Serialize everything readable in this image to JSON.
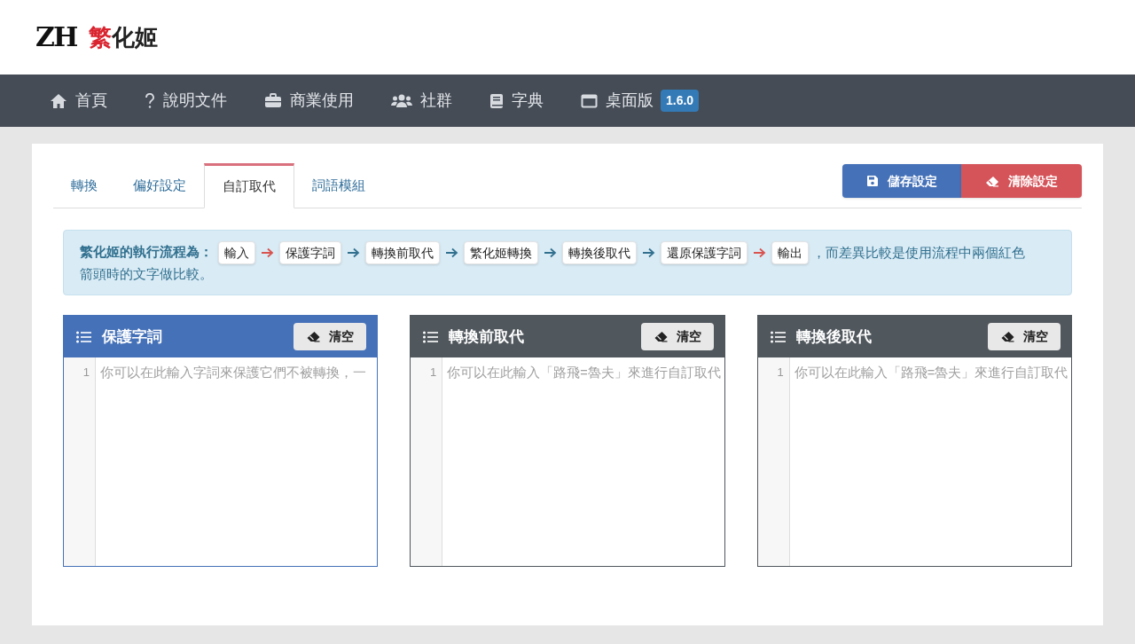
{
  "logo": {
    "mark": "ZH",
    "name_accent": "繁",
    "name_rest": "化姬"
  },
  "nav": [
    {
      "label": "首頁"
    },
    {
      "label": "說明文件"
    },
    {
      "label": "商業使用"
    },
    {
      "label": "社群"
    },
    {
      "label": "字典"
    },
    {
      "label": "桌面版",
      "badge": "1.6.0"
    }
  ],
  "tabs": [
    {
      "label": "轉換",
      "selected": false
    },
    {
      "label": "偏好設定",
      "selected": false
    },
    {
      "label": "自訂取代",
      "selected": true
    },
    {
      "label": "詞語模組",
      "selected": false
    }
  ],
  "actions": [
    {
      "kind": "save",
      "label": "儲存設定"
    },
    {
      "kind": "clear",
      "label": "清除設定"
    }
  ],
  "flow": {
    "intro": "繁化姬的執行流程為：",
    "steps": [
      {
        "label": "輸入"
      },
      {
        "label": "保護字詞",
        "red_arrow": true
      },
      {
        "label": "轉換前取代",
        "red_arrow": false
      },
      {
        "label": "繁化姬轉換",
        "red_arrow": false
      },
      {
        "label": "轉換後取代",
        "red_arrow": false
      },
      {
        "label": "還原保護字詞",
        "red_arrow": false
      },
      {
        "label": "輸出",
        "red_arrow": true
      }
    ],
    "outro": [
      "，而差異比較是使用流程中兩個紅色",
      "箭頭時的文字做比較。"
    ]
  },
  "editors": [
    {
      "title": "保護字詞",
      "clear_button": "清空",
      "selected": true,
      "line_number": "1",
      "placeholder": "你可以在此輸入字詞來保護它們不被轉換，一"
    },
    {
      "title": "轉換前取代",
      "clear_button": "清空",
      "selected": false,
      "line_number": "1",
      "placeholder": "你可以在此輸入「路飛=魯夫」來進行自訂取代"
    },
    {
      "title": "轉換後取代",
      "clear_button": "清空",
      "selected": false,
      "line_number": "1",
      "placeholder": "你可以在此輸入「路飛=魯夫」來進行自訂取代"
    }
  ]
}
